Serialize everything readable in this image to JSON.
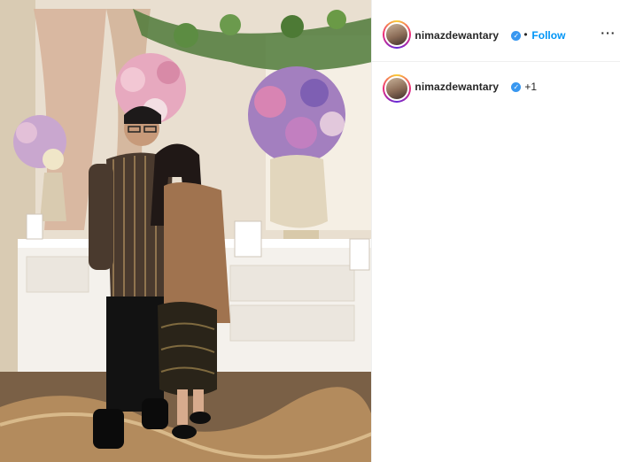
{
  "post": {
    "photo": {
      "description_icon": "photo-image"
    },
    "header": {
      "username": "nimazdewantary",
      "separator": "•",
      "follow_label": "Follow",
      "more_label": "···",
      "verified_glyph": "✓"
    },
    "caption": {
      "username": "nimazdewantary",
      "verified_glyph": "✓",
      "tagged_count": "+1"
    }
  },
  "colors": {
    "follow_blue": "#0095f6",
    "verified_blue": "#3897f0",
    "divider": "#efefef"
  }
}
